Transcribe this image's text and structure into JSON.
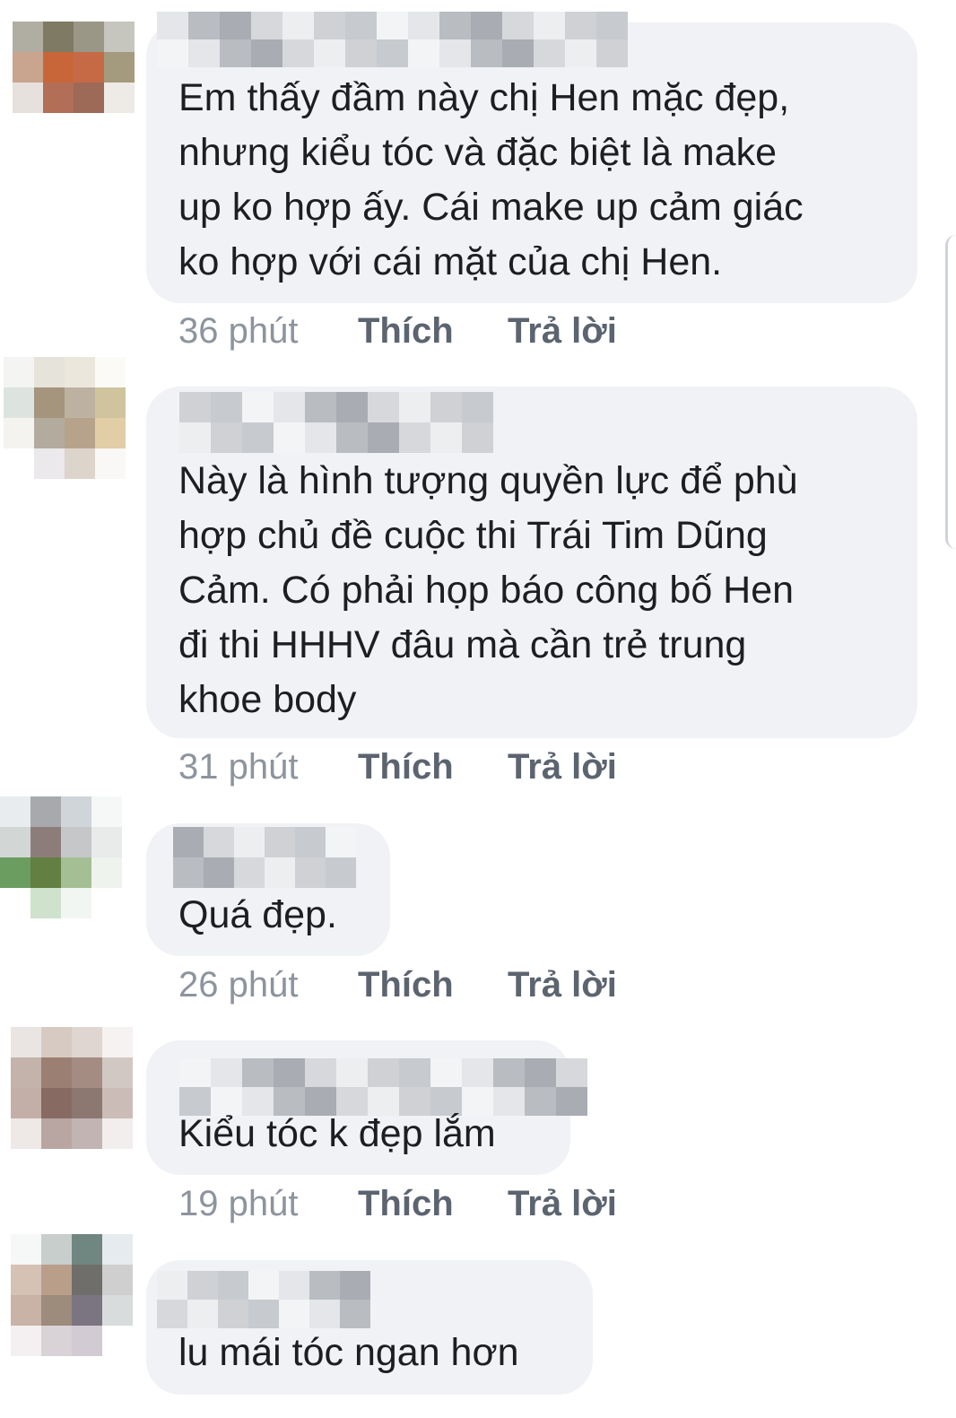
{
  "comments": [
    {
      "text": "Em thấy đầm này chị Hen mặc đẹp,\nnhưng kiểu tóc và đặc biệt là make\nup ko hợp ấy. Cái make up cảm giác\nko hợp với cái mặt của chị Hen.",
      "time": "36 phút",
      "like": "Thích",
      "reply": "Trả lời"
    },
    {
      "text": "Này là hình tượng quyền lực để phù\nhợp chủ đề cuộc thi Trái Tim Dũng\nCảm. Có phải họp báo công bố Hen\nđi thi HHHV đâu mà cần trẻ trung\nkhoe body",
      "time": "31 phút",
      "like": "Thích",
      "reply": "Trả lời"
    },
    {
      "text": "Quá đẹp.",
      "time": "26 phút",
      "like": "Thích",
      "reply": "Trả lời"
    },
    {
      "text": "Kiểu tóc k đẹp lắm",
      "time": "19 phút",
      "like": "Thích",
      "reply": "Trả lời"
    },
    {
      "text": "lu mái tóc ngan hơn",
      "time": "",
      "like": "",
      "reply": ""
    }
  ],
  "colors": {
    "bubble": "#f0f2f5",
    "meta_time": "#8d949e",
    "meta_action": "#5c6470",
    "text": "#1c1e21"
  },
  "avatar_pixels": [
    [
      "#b0aea2",
      "#7e7a64",
      "#9b9787",
      "#c6c6bf",
      "#c9a48f",
      "#c8663a",
      "#c56a45",
      "#a49a7d",
      "#e6e1dc",
      "#b26e56",
      "#9c6a57",
      "#eeeae6",
      "#ffffff",
      "#ffffff",
      "#ffffff",
      "#ffffff"
    ],
    [
      "#f4f4f2",
      "#e6e3da",
      "#ebe7dd",
      "#fbfaf7",
      "#dde3df",
      "#a5957c",
      "#bdb2a1",
      "#cfc49e",
      "#f4f3f0",
      "#b4ab9f",
      "#b7a38c",
      "#e1cea6",
      "#ffffff",
      "#ebe9ec",
      "#ddd4cc",
      "#f9f8f6"
    ],
    [
      "#e9ecee",
      "#a7a9ad",
      "#cfd5d8",
      "#f6f7f7",
      "#d2d6d5",
      "#8d7d7a",
      "#c5c7c9",
      "#e8ebea",
      "#6b9c60",
      "#637f41",
      "#a4bf94",
      "#eff3ee",
      "#ffffff",
      "#cee2cc",
      "#f2f6f2",
      "#ffffff"
    ],
    [
      "#eae5e2",
      "#d7cac3",
      "#dfd5d1",
      "#f5f2f1",
      "#c3b3aa",
      "#9b7f72",
      "#a58c82",
      "#d2c8c3",
      "#c4aea8",
      "#876b63",
      "#8d7771",
      "#cbbcb8",
      "#eee8e6",
      "#b9a6a3",
      "#c1b4b2",
      "#f1eeed"
    ],
    [
      "#f6f7f7",
      "#c8cecc",
      "#6f8780",
      "#e5ebee",
      "#d5c2b5",
      "#b99e89",
      "#6f6e6a",
      "#cfcfcf",
      "#c8b3a6",
      "#9d8b7b",
      "#7b7582",
      "#d9dcdc",
      "#f4f0f2",
      "#d9d3d8",
      "#d2cbd3",
      "#ffffff"
    ]
  ]
}
